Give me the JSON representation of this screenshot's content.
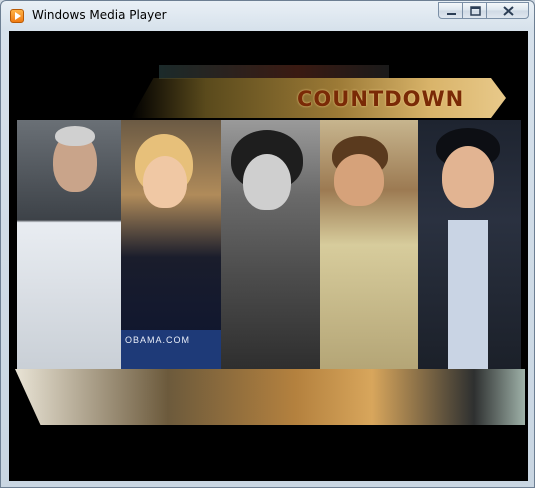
{
  "window": {
    "title": "Windows Media Player"
  },
  "titlebar_controls": {
    "minimize_icon": "minimize-icon",
    "maximize_icon": "maximize-icon",
    "close_icon": "close-icon"
  },
  "video": {
    "banner_text": "COUNTDOWN",
    "sign_text": "OBAMA.COM",
    "colors": {
      "banner_text": "#7a2a06",
      "background": "#000000",
      "banner_gold": "#d9b46a"
    }
  }
}
